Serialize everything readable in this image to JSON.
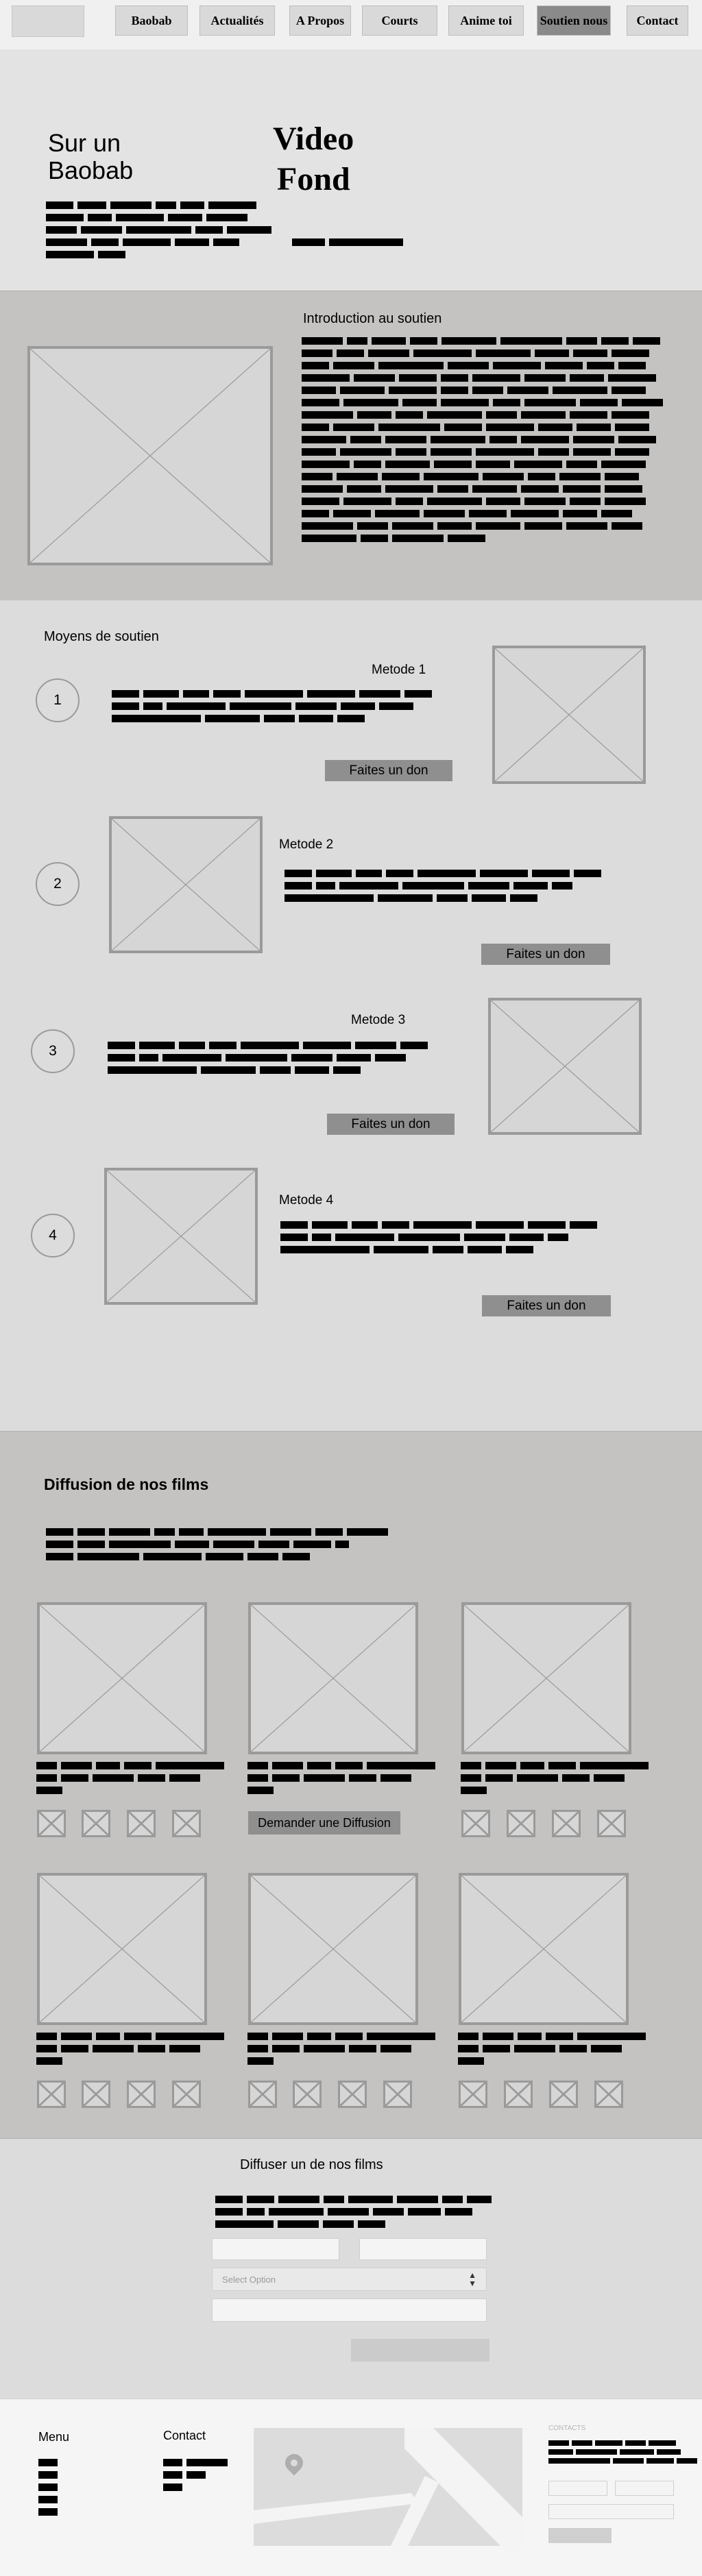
{
  "nav": {
    "items": [
      "Baobab",
      "Actualités",
      "A Propos",
      "Courts",
      "Anime toi",
      "Soutien nous",
      "Contact"
    ],
    "active": "Soutien nous"
  },
  "hero": {
    "title_line1": "Sur un",
    "title_line2": "Baobab",
    "video_line1": "Video",
    "video_line2": "Fond"
  },
  "intro": {
    "title": "Introduction au soutien"
  },
  "support": {
    "title": "Moyens de soutien",
    "methods": [
      {
        "number": "1",
        "title": "Metode 1",
        "button": "Faites un don"
      },
      {
        "number": "2",
        "title": "Metode 2",
        "button": "Faites un don"
      },
      {
        "number": "3",
        "title": "Metode 3",
        "button": "Faites un don"
      },
      {
        "number": "4",
        "title": "Metode 4",
        "button": "Faites un don"
      }
    ]
  },
  "films": {
    "title": "Diffusion de nos films",
    "request_button": "Demander une Diffusion"
  },
  "form": {
    "title": "Diffuser un de nos films",
    "select_placeholder": "Select Option"
  },
  "footer": {
    "menu_title": "Menu",
    "contact_title": "Contact",
    "contacts_label": "CONTACTS"
  },
  "colors": {
    "active_nav": "#8a8a8a",
    "button": "#8f8f8f",
    "section_dark": "#c4c3c1"
  }
}
